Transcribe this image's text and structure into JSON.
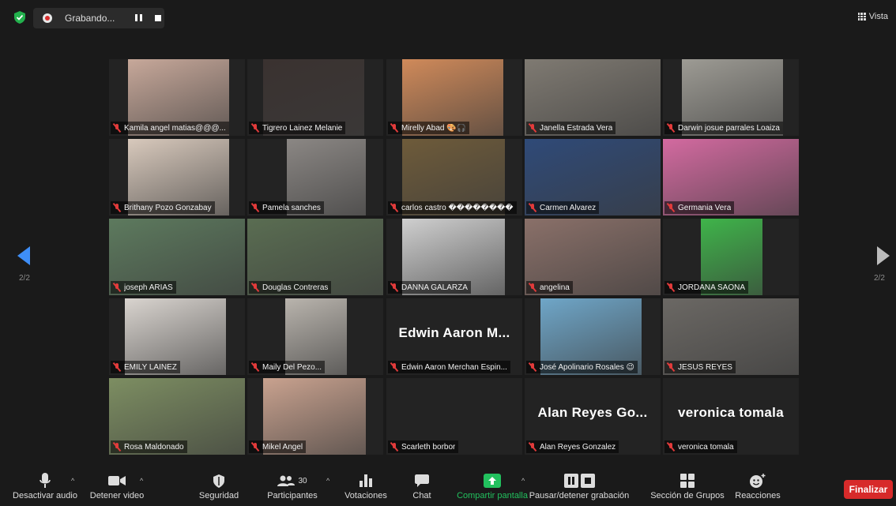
{
  "topbar": {
    "recording_label": "Grabando...",
    "view_label": "Vista"
  },
  "pagination": {
    "left": "2/2",
    "right": "2/2"
  },
  "tiles": [
    {
      "name": "Kamila angel matias@@@...",
      "big": "",
      "video": "#c7a89a"
    },
    {
      "name": "Tigrero Lainez Melanie",
      "big": "",
      "video": "#3a3230"
    },
    {
      "name": "Mirelly Abad 🎨🎧",
      "big": "",
      "video": "#d08a5a"
    },
    {
      "name": "Janella Estrada Vera",
      "big": "",
      "video": "#7f7a72"
    },
    {
      "name": "Darwin josue parrales Loaiza",
      "big": "",
      "video": "#9d9b94"
    },
    {
      "name": "Brithany Pozo Gonzabay",
      "big": "",
      "video": "#d8c9bc"
    },
    {
      "name": "Pamela  sanches",
      "big": "",
      "video": "#8b8784"
    },
    {
      "name": "carlos castro ��������",
      "big": "",
      "video": "#6e5b3a"
    },
    {
      "name": "Carmen Alvarez",
      "big": "",
      "video": "#2f4a78"
    },
    {
      "name": "Germania Vera",
      "big": "",
      "video": "#d36aa0"
    },
    {
      "name": "joseph ARIAS",
      "big": "",
      "video": "#5d7a5e"
    },
    {
      "name": "Douglas Contreras",
      "big": "",
      "video": "#5a6d52"
    },
    {
      "name": "DANNA GALARZA",
      "big": "",
      "video": "#cfcfcf"
    },
    {
      "name": "angelina",
      "big": "",
      "video": "#8a7069"
    },
    {
      "name": "JORDANA SAONA",
      "big": "",
      "video": "#3fb44a"
    },
    {
      "name": "EMILY  LAINEZ",
      "big": "",
      "video": "#d9d4cf"
    },
    {
      "name": "Maily Del Pezo...",
      "big": "",
      "video": "#b9b4ad"
    },
    {
      "name": "Edwin Aaron Merchan Espin...",
      "big": "Edwin Aaron M...",
      "video": ""
    },
    {
      "name": "José Apolinario Rosales 😉",
      "big": "",
      "video": "#6fa6c8"
    },
    {
      "name": "JESUS REYES",
      "big": "",
      "video": "#6b6864"
    },
    {
      "name": "Rosa Maldonado",
      "big": "",
      "video": "#7d8e62"
    },
    {
      "name": "Mikel Angel",
      "big": "",
      "video": "#c9a28f"
    },
    {
      "name": "Scarleth borbor",
      "big": "",
      "video": ""
    },
    {
      "name": "Alan  Reyes Gonzalez",
      "big": "Alan  Reyes Go...",
      "video": ""
    },
    {
      "name": "veronica tomala",
      "big": "veronica tomala",
      "video": ""
    }
  ],
  "toolbar": {
    "mute": "Desactivar audio",
    "video": "Detener video",
    "security": "Seguridad",
    "participants": "Participantes",
    "participants_count": "30",
    "polls": "Votaciones",
    "chat": "Chat",
    "share": "Compartir pantalla",
    "record": "Pausar/detener grabación",
    "breakout": "Sección de Grupos",
    "reactions": "Reacciones",
    "end": "Finalizar"
  },
  "colors": {
    "active_speaker": "#e4e466",
    "share_green": "#22c15e",
    "end_red": "#d72a2a",
    "nav_blue": "#3e8ef7"
  }
}
